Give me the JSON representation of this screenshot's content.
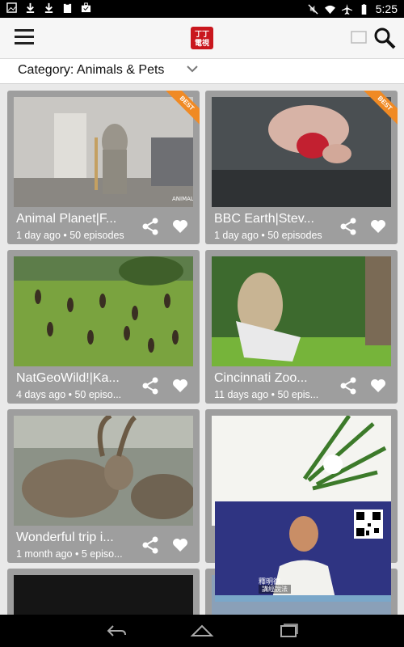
{
  "status_bar": {
    "time": "5:25",
    "left_icons": [
      "image-icon",
      "download-icon",
      "download-icon",
      "clipboard-icon",
      "briefcase-icon"
    ],
    "right_icons": [
      "mute-icon",
      "wifi-icon",
      "airplane-icon",
      "battery-icon"
    ]
  },
  "app_bar": {
    "logo_text": "丁丁\n電視",
    "icons": [
      "menu-icon",
      "cast-icon",
      "search-icon"
    ]
  },
  "category_bar": {
    "label": "Category: Animals & Pets"
  },
  "cards": [
    {
      "title": "Animal Planet|F...",
      "meta": "1 day ago • 50 episodes",
      "badge": "BEST"
    },
    {
      "title": "BBC Earth|Stev...",
      "meta": "1 day ago • 50 episodes",
      "badge": "BEST"
    },
    {
      "title": "NatGeoWild!|Ka...",
      "meta": "4 days ago • 50 episo...",
      "badge": ""
    },
    {
      "title": "Cincinnati Zoo...",
      "meta": "11 days ago • 50 epis...",
      "badge": ""
    },
    {
      "title": "Wonderful trip i...",
      "meta": "1 month ago • 5 episo...",
      "badge": ""
    },
    {
      "title": "",
      "meta": "",
      "badge": ""
    }
  ],
  "pip": {
    "caption_line1": "釋明德",
    "caption_line2": "講經說法"
  },
  "colors": {
    "brand_red": "#c9171e",
    "badge_orange": "#f08a24",
    "card_gray": "#9e9e9e"
  }
}
